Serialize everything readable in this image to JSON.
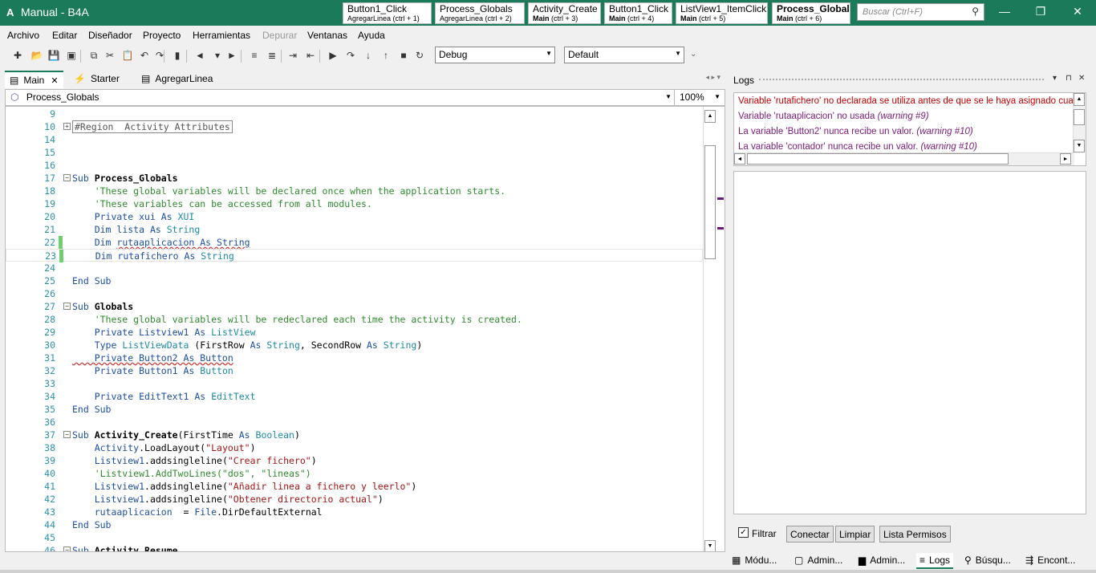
{
  "window": {
    "title": "Manual - B4A",
    "icon_glyph": "A",
    "minimize_glyph": "—",
    "maximize_glyph": "❐",
    "close_glyph": "✕"
  },
  "quick_tabs": [
    {
      "title": "Button1_Click",
      "module": "",
      "shortcut": "AgregarLinea  (ctrl + 1)"
    },
    {
      "title": "Process_Globals",
      "module": "",
      "shortcut": "AgregarLinea  (ctrl + 2)"
    },
    {
      "title": "Activity_Create",
      "module": "Main",
      "shortcut": " (ctrl + 3)"
    },
    {
      "title": "Button1_Click",
      "module": "Main",
      "shortcut": " (ctrl + 4)"
    },
    {
      "title": "ListView1_ItemClick",
      "module": "Main",
      "shortcut": " (ctrl + 5)"
    },
    {
      "title": "Process_Globals",
      "module": "Main",
      "shortcut": " (ctrl + 6)"
    }
  ],
  "search": {
    "placeholder": "Buscar (Ctrl+F)",
    "icon": "search-icon"
  },
  "menu": [
    "Archivo",
    "Editar",
    "Diseñador",
    "Proyecto",
    "Herramientas",
    "Depurar",
    "Ventanas",
    "Ayuda"
  ],
  "toolbar": {
    "build_config": "Debug",
    "build_config_arrow": "▼",
    "package": "Default",
    "package_arrow": "▼",
    "overflow_glyph": "⌄",
    "icons": [
      "new-file-icon",
      "open-icon",
      "save-icon",
      "save-all-icon",
      "copy-icon",
      "cut-icon",
      "paste-icon",
      "undo-icon",
      "redo-icon",
      "bookmark-icon",
      "back-icon",
      "back-dropdown-icon",
      "forward-icon",
      "comment-icon",
      "uncomment-icon",
      "indent-icon",
      "outdent-icon",
      "run-icon",
      "step-over-icon",
      "step-into-icon",
      "step-out-icon",
      "stop-icon",
      "restart-icon"
    ],
    "glyphs": [
      "✚",
      "📂",
      "💾",
      "▣",
      "⧉",
      "✂",
      "📋",
      "↶",
      "↷",
      "▮",
      "◄",
      "▾",
      "►",
      "≡",
      "≣",
      "⇥",
      "⇤",
      "▶",
      "↷",
      "↓",
      "↑",
      "■",
      "↻"
    ]
  },
  "editor_tabs": [
    {
      "label": "Main",
      "icon": "module-icon",
      "glyph": "▤",
      "active": true,
      "close": "✕"
    },
    {
      "label": "Starter",
      "icon": "service-icon",
      "glyph": "⚡",
      "active": false
    },
    {
      "label": "AgregarLinea",
      "icon": "module-icon",
      "glyph": "▤",
      "active": false
    }
  ],
  "tab_nav": "◂  ▸  ▾",
  "module_selector": {
    "value": "Process_Globals",
    "icon": "cube-icon",
    "glyph": "⬡",
    "arrow": "▼"
  },
  "zoom": {
    "value": "100%",
    "arrow": "▼"
  },
  "scroll_glyphs": {
    "up": "▲",
    "down": "▼",
    "left": "◄",
    "right": "►"
  },
  "code_lines": [
    {
      "n": "9",
      "parts": []
    },
    {
      "n": "10",
      "fold": "+",
      "parts": [
        {
          "t": "#Region  Activity Attributes",
          "c": "region-box"
        }
      ]
    },
    {
      "n": "14",
      "parts": []
    },
    {
      "n": "15",
      "parts": []
    },
    {
      "n": "16",
      "parts": []
    },
    {
      "n": "17",
      "fold": "−",
      "parts": [
        {
          "t": "Sub ",
          "c": "kw"
        },
        {
          "t": "Process_Globals",
          "c": "bd"
        }
      ]
    },
    {
      "n": "18",
      "parts": [
        {
          "t": "    'These global variables will be declared once when the application starts.",
          "c": "cm"
        }
      ]
    },
    {
      "n": "19",
      "parts": [
        {
          "t": "    'These variables can be accessed from all modules.",
          "c": "cm"
        }
      ]
    },
    {
      "n": "20",
      "parts": [
        {
          "t": "    Private ",
          "c": "kw"
        },
        {
          "t": "xui ",
          "c": "kw"
        },
        {
          "t": "As ",
          "c": "kw"
        },
        {
          "t": "XUI",
          "c": "ty"
        }
      ]
    },
    {
      "n": "21",
      "parts": [
        {
          "t": "    Dim ",
          "c": "kw"
        },
        {
          "t": "lista ",
          "c": "kw"
        },
        {
          "t": "As ",
          "c": "kw"
        },
        {
          "t": "String",
          "c": "ty"
        }
      ]
    },
    {
      "n": "22",
      "marker": "#6fcf6f",
      "parts": [
        {
          "t": "    Dim ",
          "c": "kw"
        },
        {
          "t": "rutaaplicacion As String",
          "c": "kw squig"
        }
      ]
    },
    {
      "n": "23",
      "marker": "#6fcf6f",
      "current": true,
      "parts": [
        {
          "t": "    Dim ",
          "c": "kw"
        },
        {
          "t": "rutafichero ",
          "c": "kw"
        },
        {
          "t": "As ",
          "c": "kw"
        },
        {
          "t": "String",
          "c": "ty"
        }
      ]
    },
    {
      "n": "24",
      "parts": []
    },
    {
      "n": "25",
      "parts": [
        {
          "t": "End Sub",
          "c": "kw"
        }
      ]
    },
    {
      "n": "26",
      "parts": []
    },
    {
      "n": "27",
      "fold": "−",
      "parts": [
        {
          "t": "Sub ",
          "c": "kw"
        },
        {
          "t": "Globals",
          "c": "bd"
        }
      ]
    },
    {
      "n": "28",
      "parts": [
        {
          "t": "    'These global variables will be redeclared each time the activity is created.",
          "c": "cm"
        }
      ]
    },
    {
      "n": "29",
      "parts": [
        {
          "t": "    Private ",
          "c": "kw"
        },
        {
          "t": "Listview1 ",
          "c": "kw"
        },
        {
          "t": "As ",
          "c": "kw"
        },
        {
          "t": "ListView",
          "c": "ty"
        }
      ]
    },
    {
      "n": "30",
      "parts": [
        {
          "t": "    Type ",
          "c": "kw"
        },
        {
          "t": "ListViewData ",
          "c": "ty"
        },
        {
          "t": "(FirstRow ",
          "c": ""
        },
        {
          "t": "As ",
          "c": "kw"
        },
        {
          "t": "String",
          "c": "ty"
        },
        {
          "t": ", SecondRow ",
          "c": ""
        },
        {
          "t": "As ",
          "c": "kw"
        },
        {
          "t": "String",
          "c": "ty"
        },
        {
          "t": ")",
          "c": ""
        }
      ]
    },
    {
      "n": "31",
      "parts": [
        {
          "t": "    Private Button2 As Button",
          "c": "kw squig"
        }
      ]
    },
    {
      "n": "32",
      "parts": [
        {
          "t": "    Private ",
          "c": "kw"
        },
        {
          "t": "Button1 ",
          "c": "kw"
        },
        {
          "t": "As ",
          "c": "kw"
        },
        {
          "t": "Button",
          "c": "ty"
        }
      ]
    },
    {
      "n": "33",
      "parts": []
    },
    {
      "n": "34",
      "parts": [
        {
          "t": "    Private ",
          "c": "kw"
        },
        {
          "t": "EditText1 ",
          "c": "kw"
        },
        {
          "t": "As ",
          "c": "kw"
        },
        {
          "t": "EditText",
          "c": "ty"
        }
      ]
    },
    {
      "n": "35",
      "parts": [
        {
          "t": "End Sub",
          "c": "kw"
        }
      ]
    },
    {
      "n": "36",
      "parts": []
    },
    {
      "n": "37",
      "fold": "−",
      "parts": [
        {
          "t": "Sub ",
          "c": "kw"
        },
        {
          "t": "Activity_Create",
          "c": "bd"
        },
        {
          "t": "(FirstTime ",
          "c": ""
        },
        {
          "t": "As ",
          "c": "kw"
        },
        {
          "t": "Boolean",
          "c": "ty"
        },
        {
          "t": ")",
          "c": ""
        }
      ]
    },
    {
      "n": "38",
      "parts": [
        {
          "t": "    Activity",
          "c": "kw"
        },
        {
          "t": ".LoadLayout(",
          "c": ""
        },
        {
          "t": "\"Layout\"",
          "c": "st"
        },
        {
          "t": ")",
          "c": ""
        }
      ]
    },
    {
      "n": "39",
      "parts": [
        {
          "t": "    Listview1",
          "c": "kw"
        },
        {
          "t": ".addsingleline(",
          "c": ""
        },
        {
          "t": "\"Crear fichero\"",
          "c": "st"
        },
        {
          "t": ")",
          "c": ""
        }
      ]
    },
    {
      "n": "40",
      "parts": [
        {
          "t": "    'Listview1.AddTwoLines(\"dos\", \"lineas\")",
          "c": "cm"
        }
      ]
    },
    {
      "n": "41",
      "parts": [
        {
          "t": "    Listview1",
          "c": "kw"
        },
        {
          "t": ".addsingleline(",
          "c": ""
        },
        {
          "t": "\"Añadir linea a fichero y leerlo\"",
          "c": "st"
        },
        {
          "t": ")",
          "c": ""
        }
      ]
    },
    {
      "n": "42",
      "parts": [
        {
          "t": "    Listview1",
          "c": "kw"
        },
        {
          "t": ".addsingleline(",
          "c": ""
        },
        {
          "t": "\"Obtener directorio actual\"",
          "c": "st"
        },
        {
          "t": ")",
          "c": ""
        }
      ]
    },
    {
      "n": "43",
      "parts": [
        {
          "t": "    rutaaplicacion ",
          "c": "kw"
        },
        {
          "t": " = ",
          "c": ""
        },
        {
          "t": "File",
          "c": "kw"
        },
        {
          "t": ".DirDefaultExternal",
          "c": ""
        }
      ]
    },
    {
      "n": "44",
      "parts": [
        {
          "t": "End Sub",
          "c": "kw"
        }
      ]
    },
    {
      "n": "45",
      "parts": []
    },
    {
      "n": "46",
      "fold": "−",
      "parts": [
        {
          "t": "Sub ",
          "c": "kw"
        },
        {
          "t": "Activity_Resume",
          "c": "bd"
        }
      ]
    }
  ],
  "logs": {
    "title": "Logs",
    "controls": [
      "▾",
      "⊓",
      "✕"
    ],
    "entries": [
      {
        "kind": "err",
        "text": "Variable 'rutafichero' no declarada se utiliza antes de que se le haya asignado cualquier valor.",
        "warning": ""
      },
      {
        "kind": "warn",
        "text": "Variable 'rutaaplicacion' no usada ",
        "warning": "(warning #9)"
      },
      {
        "kind": "warn",
        "text": "La variable 'Button2' nunca recibe un valor. ",
        "warning": "(warning #10)"
      },
      {
        "kind": "warn",
        "text": "La variable 'contador' nunca recibe un valor. ",
        "warning": "(warning #10)"
      }
    ],
    "filter_label": "Filtrar",
    "filter_check": "✓",
    "buttons": [
      "Conectar",
      "Limpiar",
      "Lista Permisos"
    ]
  },
  "bottom_tabs": [
    {
      "label": "Módu...",
      "icon": "modules-icon",
      "glyph": "▦"
    },
    {
      "label": "Admin...",
      "icon": "files-icon",
      "glyph": "▢"
    },
    {
      "label": "Admin...",
      "icon": "folder-icon",
      "glyph": "▆"
    },
    {
      "label": "Logs",
      "icon": "logs-icon",
      "glyph": "≡",
      "active": true
    },
    {
      "label": "Búsqu...",
      "icon": "search-icon",
      "glyph": "⚲"
    },
    {
      "label": "Encont...",
      "icon": "find-icon",
      "glyph": "⇶"
    }
  ]
}
